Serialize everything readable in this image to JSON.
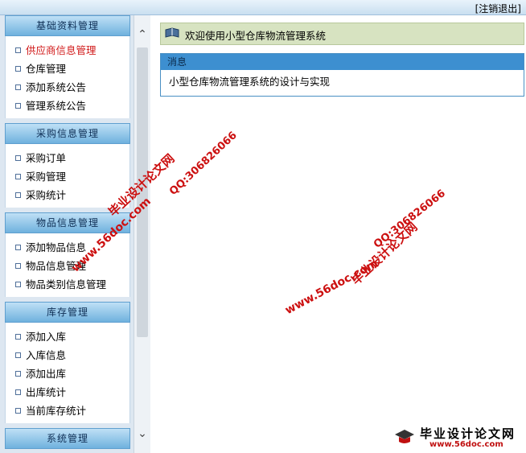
{
  "header": {
    "logout_label": "[注销退出]"
  },
  "sidebar": {
    "groups": [
      {
        "title": "基础资料管理",
        "items": [
          "供应商信息管理",
          "仓库管理",
          "添加系统公告",
          "管理系统公告"
        ]
      },
      {
        "title": "采购信息管理",
        "items": [
          "采购订单",
          "采购管理",
          "采购统计"
        ]
      },
      {
        "title": "物品信息管理",
        "items": [
          "添加物品信息",
          "物品信息管理",
          "物品类别信息管理"
        ]
      },
      {
        "title": "库存管理",
        "items": [
          "添加入库",
          "入库信息",
          "添加出库",
          "出库统计",
          "当前库存统计"
        ]
      },
      {
        "title": "系统管理",
        "items": []
      }
    ],
    "active_item": "供应商信息管理"
  },
  "main": {
    "welcome_text": "欢迎使用小型仓库物流管理系统",
    "message": {
      "header": "消息",
      "body": "小型仓库物流管理系统的设计与实现"
    }
  },
  "watermarks": {
    "site_name": "毕业设计论文网",
    "url": "www.56doc.com",
    "qq": "QQ:306826066"
  },
  "brand": {
    "name": "毕业设计论文网",
    "url": "www.56doc.com"
  },
  "colors": {
    "active_item": "#d11a1a",
    "header_blue": "#3d8fd0",
    "welcome_bg": "#d7e3c1"
  }
}
